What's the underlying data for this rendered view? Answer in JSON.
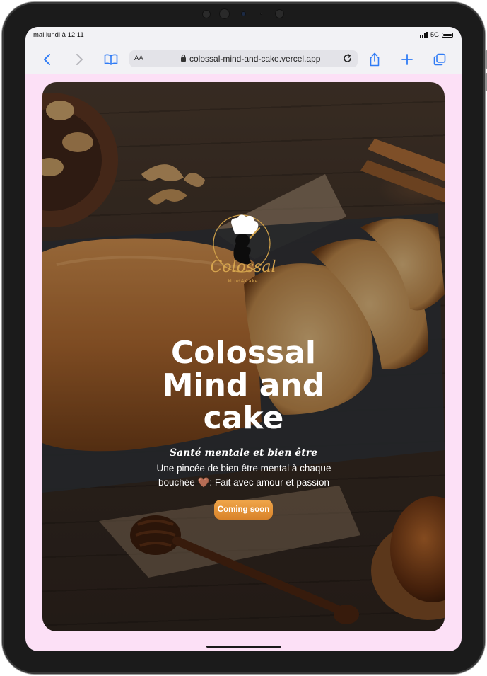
{
  "status": {
    "time": "mai lundi à 12:11",
    "network": "5G"
  },
  "browser": {
    "text_size": "AA",
    "url": "colossal-mind-and-cake.vercel.app",
    "page_load_progress": 0.41,
    "icons": [
      "chevron-left-icon",
      "chevron-right-icon",
      "book-icon",
      "lock-icon",
      "reload-icon",
      "share-icon",
      "plus-icon",
      "tabs-icon"
    ]
  },
  "hero": {
    "logo_text": "Colossal",
    "logo_subtext": "Mind&Cake",
    "title_lines": [
      "Colossal",
      "Mind and",
      "cake"
    ],
    "tagline": "Santé mentale et bien être",
    "description": "Une pincée de bien être mental à chaque bouchée 🤎: Fait avec amour et passion",
    "cta_label": "Coming soon"
  },
  "colors": {
    "page_background": "#fce0f6",
    "accent": "#e08f35",
    "link_blue": "#2f7bf5"
  }
}
